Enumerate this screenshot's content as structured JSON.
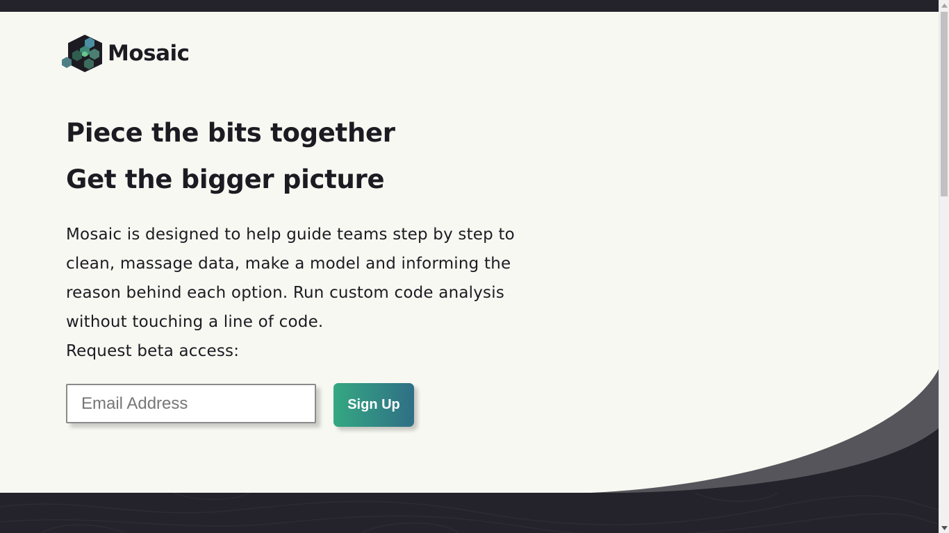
{
  "brand": {
    "name": "Mosaic",
    "logo_icon": "mosaic-cubes-logo"
  },
  "hero": {
    "headline_1": "Piece the bits together",
    "headline_2": "Get the bigger picture",
    "description": "Mosaic is designed to help guide teams step by step to clean, massage data, make a model and informing the reason behind each option. Run custom code analysis without touching a line of code.",
    "beta_prompt": "Request beta access:"
  },
  "signup_form": {
    "email_placeholder": "Email Address",
    "email_value": "",
    "submit_label": "Sign Up"
  },
  "colors": {
    "hero_background": "#f8f8f2",
    "dark_background": "#24222a",
    "text": "#1c1b22",
    "button_gradient_start": "#35a882",
    "button_gradient_end": "#2f6f86",
    "wave_gray": "#56555b"
  },
  "scrollbar": {
    "up_icon": "scroll-up-arrow-icon",
    "down_icon": "scroll-down-arrow-icon"
  }
}
